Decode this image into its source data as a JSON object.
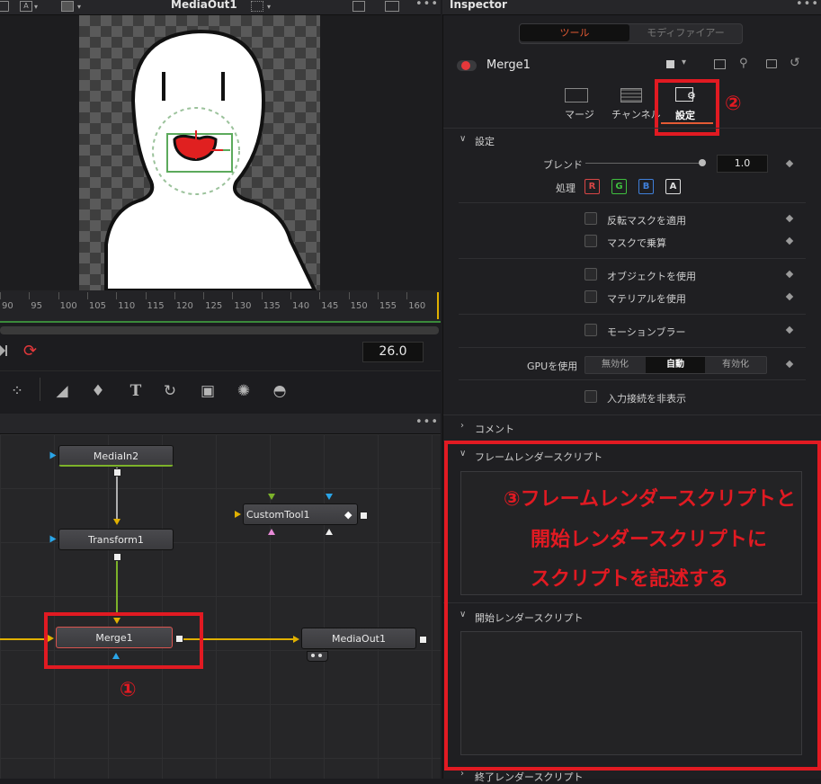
{
  "viewer": {
    "title": "MediaOut1",
    "ticks": [
      "90",
      "95",
      "100",
      "105",
      "110",
      "115",
      "120",
      "125",
      "130",
      "135",
      "140",
      "145",
      "150",
      "155",
      "160"
    ],
    "current_frame": "26.0"
  },
  "nodes": {
    "mediain2": "MediaIn2",
    "transform1": "Transform1",
    "customtool1": "CustomTool1",
    "merge1": "Merge1",
    "mediaout1": "MediaOut1"
  },
  "annotations": {
    "one": "①",
    "two": "②",
    "three_line1": "③フレームレンダースクリプトと",
    "three_line2": "開始レンダースクリプトに",
    "three_line3": "スクリプトを記述する"
  },
  "inspector": {
    "title": "Inspector",
    "segment_tool": "ツール",
    "segment_modifier": "モディファイアー",
    "node_name": "Merge1",
    "tabs": [
      {
        "label": "マージ",
        "icon": "merge-icon"
      },
      {
        "label": "チャンネル",
        "icon": "channel-icon"
      },
      {
        "label": "設定",
        "icon": "settings-icon"
      }
    ],
    "settings_header": "設定",
    "blend_label": "ブレンド",
    "blend_value": "1.0",
    "blend_fraction": 1.0,
    "process_label": "処理",
    "channels": [
      "R",
      "G",
      "B",
      "A"
    ],
    "checkboxes": {
      "invert_mask": "反転マスクを適用",
      "mask_multiply": "マスクで乗算",
      "use_object": "オブジェクトを使用",
      "use_material": "マテリアルを使用",
      "motion_blur": "モーションブラー",
      "hide_input": "入力接続を非表示"
    },
    "gpu_label": "GPUを使用",
    "gpu_options": [
      "無効化",
      "自動",
      "有効化"
    ],
    "gpu_selected": "自動",
    "comment_section": "コメント",
    "frame_render_section": "フレームレンダースクリプト",
    "start_render_section": "開始レンダースクリプト",
    "end_render_section": "終了レンダースクリプト"
  },
  "colors": {
    "accent_red": "#e11a22",
    "tab_underline": "#e35a34",
    "ruler_green": "#3a8a3a"
  }
}
